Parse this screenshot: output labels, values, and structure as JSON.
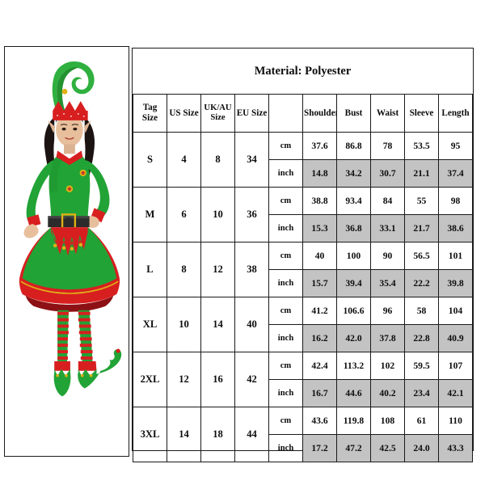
{
  "product_image": {
    "alt": "Woman wearing green and red Christmas elf costume with pointed hat, belted dress, striped stockings and curled elf shoes",
    "colors": {
      "green": "#22a336",
      "green_dark": "#17832a",
      "red": "#d81f20",
      "red_dark": "#a81216",
      "gold": "#e0b015",
      "belt_black": "#2b2b2b",
      "skin": "#e8bf9c",
      "hair": "#1c1412",
      "background": "#ffffff"
    }
  },
  "chart": {
    "title": "Material: Polyester",
    "headers": {
      "tag_size": "Tag Size",
      "us_size": "US Size",
      "uk_au_size": "UK/AU Size",
      "eu_size": "EU Size",
      "unit": "",
      "measurements": [
        "Shoulder",
        "Bust",
        "Waist",
        "Sleeve",
        "Length"
      ]
    },
    "units": {
      "cm": "cm",
      "inch": "inch"
    },
    "shaded_row_color": "#c3c3c3",
    "rows": [
      {
        "tag_size": "S",
        "us_size": "4",
        "uk_au_size": "8",
        "eu_size": "34",
        "cm": [
          "37.6",
          "86.8",
          "78",
          "53.5",
          "95"
        ],
        "inch": [
          "14.8",
          "34.2",
          "30.7",
          "21.1",
          "37.4"
        ]
      },
      {
        "tag_size": "M",
        "us_size": "6",
        "uk_au_size": "10",
        "eu_size": "36",
        "cm": [
          "38.8",
          "93.4",
          "84",
          "55",
          "98"
        ],
        "inch": [
          "15.3",
          "36.8",
          "33.1",
          "21.7",
          "38.6"
        ]
      },
      {
        "tag_size": "L",
        "us_size": "8",
        "uk_au_size": "12",
        "eu_size": "38",
        "cm": [
          "40",
          "100",
          "90",
          "56.5",
          "101"
        ],
        "inch": [
          "15.7",
          "39.4",
          "35.4",
          "22.2",
          "39.8"
        ]
      },
      {
        "tag_size": "XL",
        "us_size": "10",
        "uk_au_size": "14",
        "eu_size": "40",
        "cm": [
          "41.2",
          "106.6",
          "96",
          "58",
          "104"
        ],
        "inch": [
          "16.2",
          "42.0",
          "37.8",
          "22.8",
          "40.9"
        ]
      },
      {
        "tag_size": "2XL",
        "us_size": "12",
        "uk_au_size": "16",
        "eu_size": "42",
        "cm": [
          "42.4",
          "113.2",
          "102",
          "59.5",
          "107"
        ],
        "inch": [
          "16.7",
          "44.6",
          "40.2",
          "23.4",
          "42.1"
        ]
      },
      {
        "tag_size": "3XL",
        "us_size": "14",
        "uk_au_size": "18",
        "eu_size": "44",
        "cm": [
          "43.6",
          "119.8",
          "108",
          "61",
          "110"
        ],
        "inch": [
          "17.2",
          "47.2",
          "42.5",
          "24.0",
          "43.3"
        ]
      }
    ]
  }
}
